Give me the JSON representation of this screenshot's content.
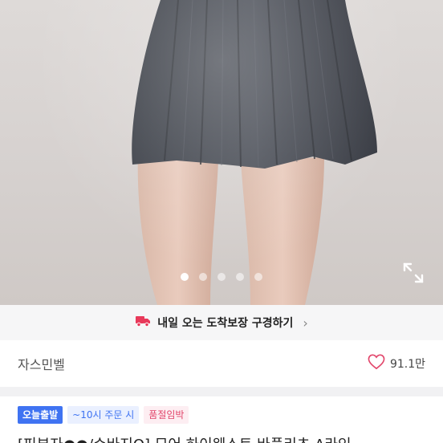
{
  "gallery": {
    "current_index": 1,
    "dots_total": 5
  },
  "delivery_banner": {
    "label": "내일 오는 도착보장 구경하기",
    "chevron": "›",
    "icon": "delivery-truck-icon",
    "accent_color": "#e8395a"
  },
  "shop": {
    "name": "자스민벨",
    "likes": "91.1만",
    "heart_color": "#e2466b"
  },
  "badges": {
    "today_shipping": "오늘출발",
    "order_time": "~10시 주문 시",
    "sold_out_soon": "품절임박"
  },
  "product": {
    "title": "[피부자●●/슈바지Q] 모어 하이웨스트 바플리츠 A라인"
  }
}
